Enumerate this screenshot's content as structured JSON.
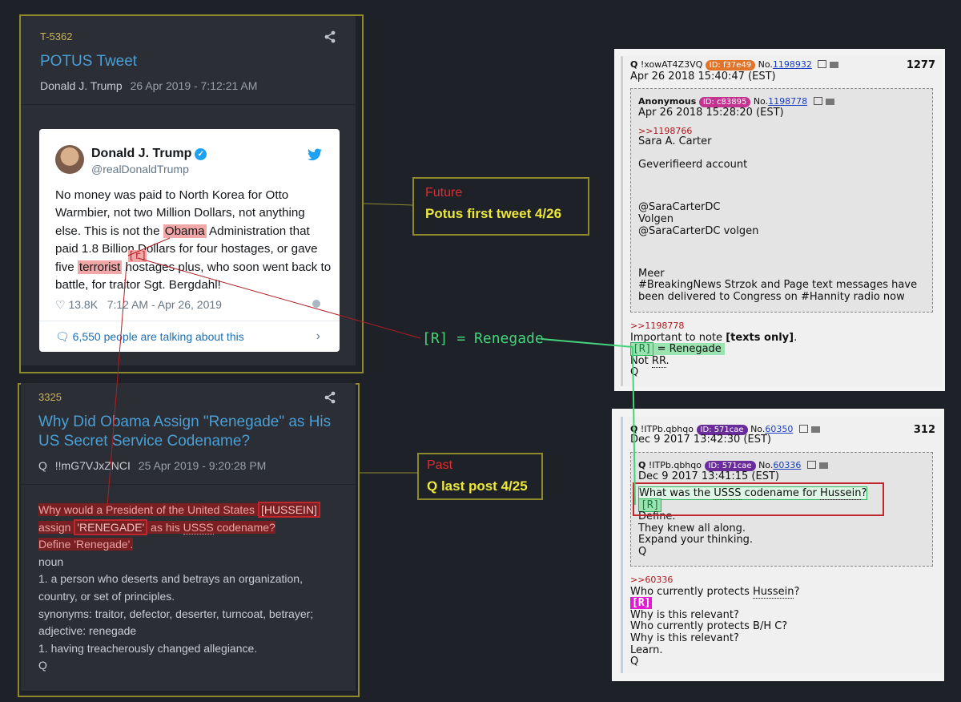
{
  "tweet_card": {
    "id": "T-5362",
    "title": "POTUS Tweet",
    "author": "Donald J. Trump",
    "date": "26 Apr 2019 - 7:12:21 AM",
    "tweet": {
      "name": "Donald J. Trump",
      "handle": "@realDonaldTrump",
      "text_parts": [
        "No money was paid to North Korea for Otto Warmbier, not two Million Dollars, not anything else. This is not the ",
        "Obama",
        " Administration that paid 1.8 Billion Dollars for four hostages, or gave five ",
        "terrorist",
        " hostages plus, who soon went back to battle, for traitor Sgt. Bergdahl!"
      ],
      "likes": "13.8K",
      "time": "7:12 AM - Apr 26, 2019",
      "talking": "6,550 people are talking about this",
      "r_marker": "[r]"
    }
  },
  "q_card": {
    "id": "3325",
    "title": "Why Did Obama Assign \"Renegade\" as His US Secret Service Codename?",
    "author": "Q",
    "trip": "!!mG7VJxZNCI",
    "date": "25 Apr 2019 - 9:20:28 PM",
    "lines": {
      "l1a": "Why would a President of the United States ",
      "l1b": "[HUSSEIN]",
      "l2a": "assign ",
      "l2b": "'RENEGADE'",
      "l2c": " as his ",
      "l2d": "USSS",
      "l2e": " codename?",
      "l3": "Define 'Renegade'.",
      "l4": "noun",
      "l5": "1. a person who deserts and betrays an organization, country, or set of principles.",
      "l6": "synonyms:  traitor, defector, deserter, turncoat, betrayer;",
      "l7": "adjective: renegade",
      "l8": "1. having treacherously changed allegiance.",
      "l9": "Q"
    }
  },
  "callouts": {
    "future": {
      "label": "Future",
      "text": "Potus first tweet  4/26"
    },
    "past": {
      "label": "Past",
      "text": "Q last post 4/25"
    },
    "renegade": "[R] = Renegade"
  },
  "post_top": {
    "name": "Q",
    "trip": "!xowAT4Z3VQ",
    "id_label": "ID: f37e49",
    "no_prefix": "No.",
    "no": "1198932",
    "count": "1277",
    "date": "Apr 26 2018 15:40:47 (EST)",
    "quote": {
      "name": "Anonymous",
      "id_label": "ID: c83895",
      "no_prefix": "No.",
      "no": "1198778",
      "date": "Apr 26 2018 15:28:20 (EST)",
      "ref": ">>1198766",
      "lines": [
        "Sara A. Carter",
        "",
        "Geverifieerd account",
        "",
        "",
        "@SaraCarterDC",
        "Volgen",
        "@SaraCarterDC volgen",
        "",
        "",
        "Meer",
        "#BreakingNews Strzok and Page text messages have been delivered to Congress on #Hannity radio now"
      ]
    },
    "ref": ">>1198778",
    "l1a": "Important to note ",
    "l1b": "[texts only]",
    "l1c": ".",
    "r": "[R]",
    "l2": " = Renegade",
    "l3a": "Not ",
    "l3b": "RR",
    "l3c": ".",
    "l4": "Q"
  },
  "post_bottom": {
    "name": "Q",
    "trip": "!ITPb.qbhqo",
    "id_label": "ID: 571cae",
    "no_prefix": "No.",
    "no": "60350",
    "count": "312",
    "date": "Dec 9 2017 13:42:30 (EST)",
    "quote": {
      "name": "Q",
      "trip": "!ITPb.qbhqo",
      "id_label": "ID: 571cae",
      "no_prefix": "No.",
      "no": "60336",
      "date": "Dec 9 2017 13:41:15 (EST)",
      "q1a": "What was the ",
      "q1b": "USSS",
      "q1c": " codename for ",
      "q1d": "Hussein",
      "q1e": "?",
      "r": "[R]",
      "lines": [
        "Define.",
        "They knew all along.",
        "Expand your thinking.",
        "Q"
      ]
    },
    "ref": ">>60336",
    "l1a": "Who currently protects ",
    "l1b": "Hussein",
    "l1c": "?",
    "r": "[R]",
    "lines": [
      "Why is this relevant?",
      "Who currently protects B/H C?",
      "Why is this relevant?",
      "Learn.",
      "Q"
    ]
  },
  "icons": {
    "share": "share-icon",
    "verified": "verified-badge-icon",
    "bird": "twitter-bird-icon",
    "heart": "heart-icon",
    "info": "info-icon",
    "comment": "comment-icon",
    "chevron": "chevron-right-icon",
    "external": "external-link-icon",
    "folder": "folder-icon"
  },
  "colors": {
    "callout_border": "#8e8a2c",
    "title_blue": "#4a9fd5",
    "accent_red": "#e12c2c",
    "accent_yellow": "#ece83a",
    "accent_green": "#44d37a"
  }
}
